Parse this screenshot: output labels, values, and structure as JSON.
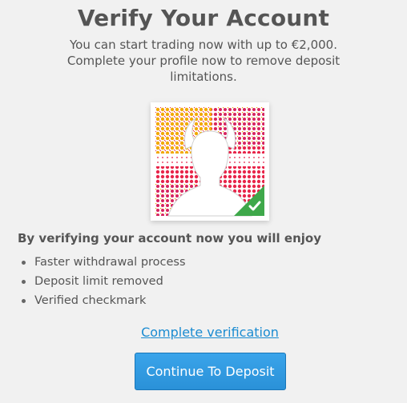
{
  "header": {
    "title": "Verify Your Account",
    "subtitle": "You can start trading now with up to €2,000. Complete your profile now to remove deposit limitations."
  },
  "avatar": {
    "icon": "profile-silhouette-icon",
    "badge_icon": "checkmark-icon",
    "colors": {
      "pattern_red": "#e8254a",
      "pattern_yellow": "#f2a800",
      "badge_green": "#3ea84a"
    }
  },
  "benefits": {
    "heading": "By verifying your account now you will enjoy",
    "items": [
      "Faster withdrawal process",
      "Deposit limit removed",
      "Verified checkmark"
    ]
  },
  "actions": {
    "verify_link": "Complete verification",
    "deposit_button": "Continue To Deposit"
  },
  "colors": {
    "link": "#1a8bd1",
    "button": "#2e99df",
    "background": "#f1f1f1",
    "text": "#555555"
  }
}
